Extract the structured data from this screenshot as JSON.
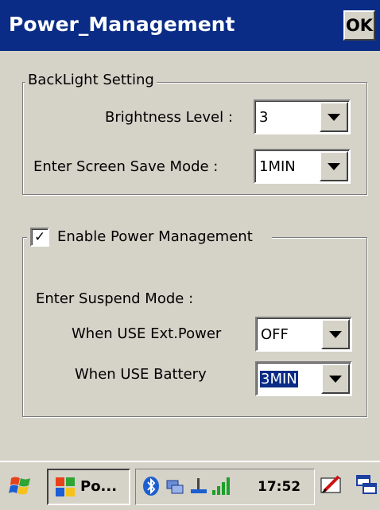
{
  "window": {
    "title": "Power_Management",
    "ok_label": "OK"
  },
  "backlight": {
    "legend": "BackLight Setting",
    "brightness_label": "Brightness Level :",
    "brightness_value": "3",
    "screensave_label": "Enter Screen  Save Mode :",
    "screensave_value": "1MIN"
  },
  "power": {
    "enable_label": "Enable Power Management",
    "enable_checked": true,
    "suspend_label": "Enter Suspend Mode :",
    "ext_power_label": "When USE Ext.Power",
    "ext_power_value": "OFF",
    "battery_label": "When USE Battery",
    "battery_value": "3MIN"
  },
  "taskbar": {
    "start_icon": "windows-flag-icon",
    "task_label": "Po...",
    "clock": "17:52",
    "tray_icons": [
      "bluetooth-icon",
      "network-icon",
      "power-plug-icon",
      "signal-bars-icon"
    ],
    "right_icons": [
      "input-panel-icon",
      "window-switch-icon"
    ]
  }
}
